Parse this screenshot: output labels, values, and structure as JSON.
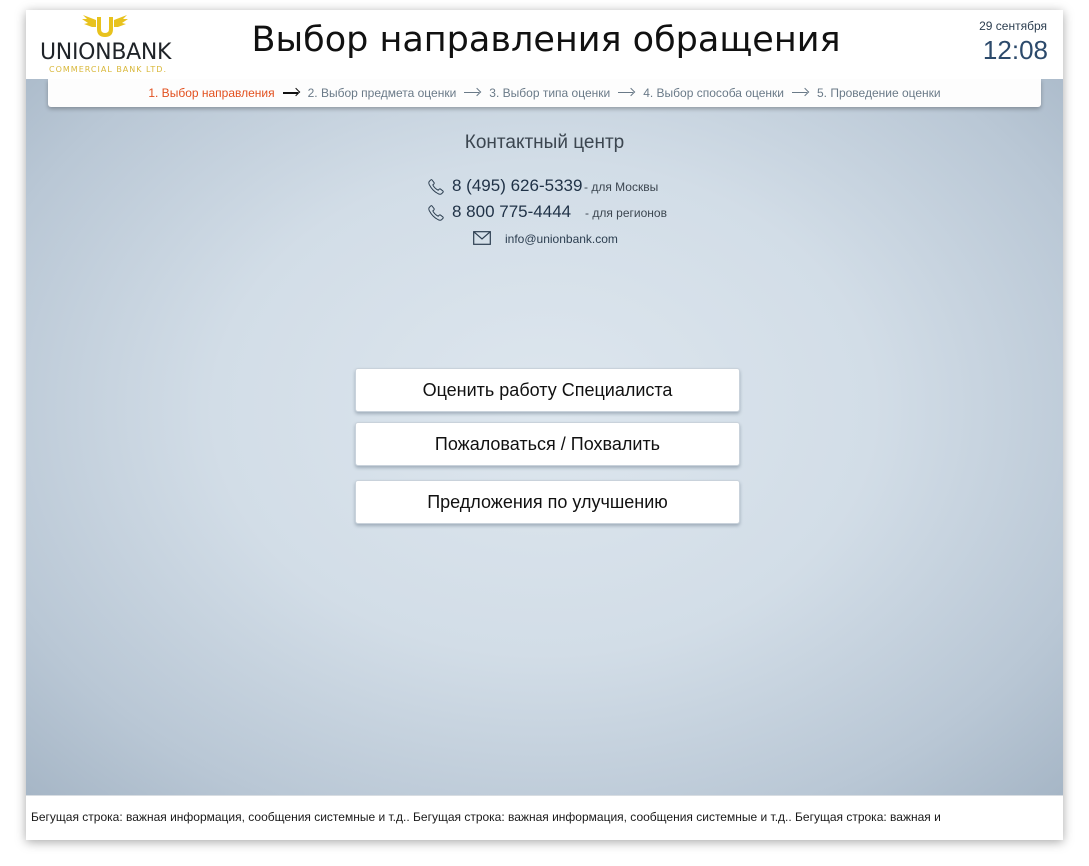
{
  "header": {
    "logo": {
      "name": "UNIONBANK",
      "subtitle": "COMMERCIAL BANK LTD."
    },
    "title": "Выбор направления обращения",
    "date": "29 сентября",
    "time": "12:08"
  },
  "steps": [
    {
      "label": "1. Выбор направления",
      "active": true
    },
    {
      "label": "2. Выбор предмета оценки",
      "active": false
    },
    {
      "label": "3. Выбор типа оценки",
      "active": false
    },
    {
      "label": "4. Выбор способа оценки",
      "active": false
    },
    {
      "label": "5. Проведение оценки",
      "active": false
    }
  ],
  "contact": {
    "title": "Контактный центр",
    "phones": [
      {
        "number": "8 (495) 626-5339",
        "note": "- для Москвы",
        "icon": "phone-icon"
      },
      {
        "number": "8 800 775-4444",
        "note": "- для регионов",
        "icon": "phone-icon"
      }
    ],
    "email": {
      "address": "info@unionbank.com",
      "icon": "envelope-icon"
    }
  },
  "actions": [
    {
      "label": "Оценить работу Специалиста"
    },
    {
      "label": "Пожаловаться / Похвалить"
    },
    {
      "label": "Предложения по улучшению"
    }
  ],
  "ticker": {
    "text": "Бегущая строка: важная информация, сообщения системные и т.д..   Бегущая строка: важная информация, сообщения системные и т.д..   Бегущая строка: важная и"
  },
  "colors": {
    "active_step": "#e2501f",
    "logo_gold": "#d9b83a",
    "time": "#2c4a6b"
  }
}
